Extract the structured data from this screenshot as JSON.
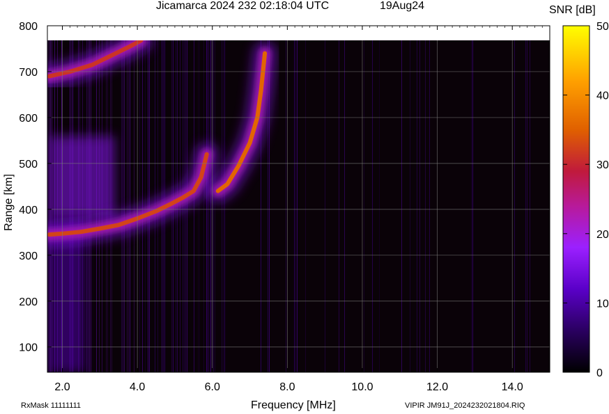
{
  "header": {
    "title": "Jicamarca 2024 232 02:18:04 UTC",
    "date": "19Aug24",
    "colorbar_title": "SNR [dB]"
  },
  "footer": {
    "rxmask": "RxMask 11111111",
    "filename": "VIPIR  JM91J_2024232021804.RIQ"
  },
  "chart_data": {
    "type": "heatmap",
    "title": "Jicamarca 2024 232 02:18:04 UTC",
    "xlabel": "Frequency [MHz]",
    "ylabel": "Range [km]",
    "xlim": [
      1.6,
      15.0
    ],
    "ylim": [
      45,
      800
    ],
    "xticks": [
      "2.0",
      "4.0",
      "6.0",
      "8.0",
      "10.0",
      "12.0",
      "14.0"
    ],
    "xtick_values": [
      2,
      4,
      6,
      8,
      10,
      12,
      14
    ],
    "yticks": [
      "100",
      "200",
      "300",
      "400",
      "500",
      "600",
      "700",
      "800"
    ],
    "ytick_values": [
      100,
      200,
      300,
      400,
      500,
      600,
      700,
      800
    ],
    "grid": true,
    "colorbar": {
      "label": "SNR [dB]",
      "range": [
        0,
        50
      ],
      "ticks": [
        "0",
        "10",
        "20",
        "30",
        "40",
        "50"
      ],
      "tick_values": [
        0,
        10,
        20,
        30,
        40,
        50
      ],
      "colors": [
        "#000000",
        "#5a00c8",
        "#9b20ff",
        "#c01a3c",
        "#e06000",
        "#ffa000",
        "#ffff00"
      ]
    },
    "traces": [
      {
        "name": "",
        "points": [
          [
            1.65,
            345
          ],
          [
            2.0,
            347
          ],
          [
            2.5,
            351
          ],
          [
            3.0,
            358
          ],
          [
            3.5,
            366
          ],
          [
            4.0,
            380
          ],
          [
            4.5,
            396
          ],
          [
            4.9,
            412
          ],
          [
            5.2,
            425
          ],
          [
            5.5,
            440
          ],
          [
            5.7,
            470
          ],
          [
            5.85,
            520
          ]
        ],
        "snr": 30
      },
      {
        "name": "",
        "points": [
          [
            6.15,
            440
          ],
          [
            6.4,
            455
          ],
          [
            6.7,
            495
          ],
          [
            7.0,
            545
          ],
          [
            7.2,
            600
          ],
          [
            7.3,
            660
          ],
          [
            7.4,
            740
          ]
        ],
        "snr": 34
      },
      {
        "name": "",
        "points": [
          [
            1.65,
            690
          ],
          [
            2.2,
            700
          ],
          [
            2.8,
            715
          ],
          [
            3.3,
            735
          ],
          [
            3.8,
            755
          ],
          [
            4.1,
            768
          ]
        ],
        "snr": 28
      }
    ]
  }
}
